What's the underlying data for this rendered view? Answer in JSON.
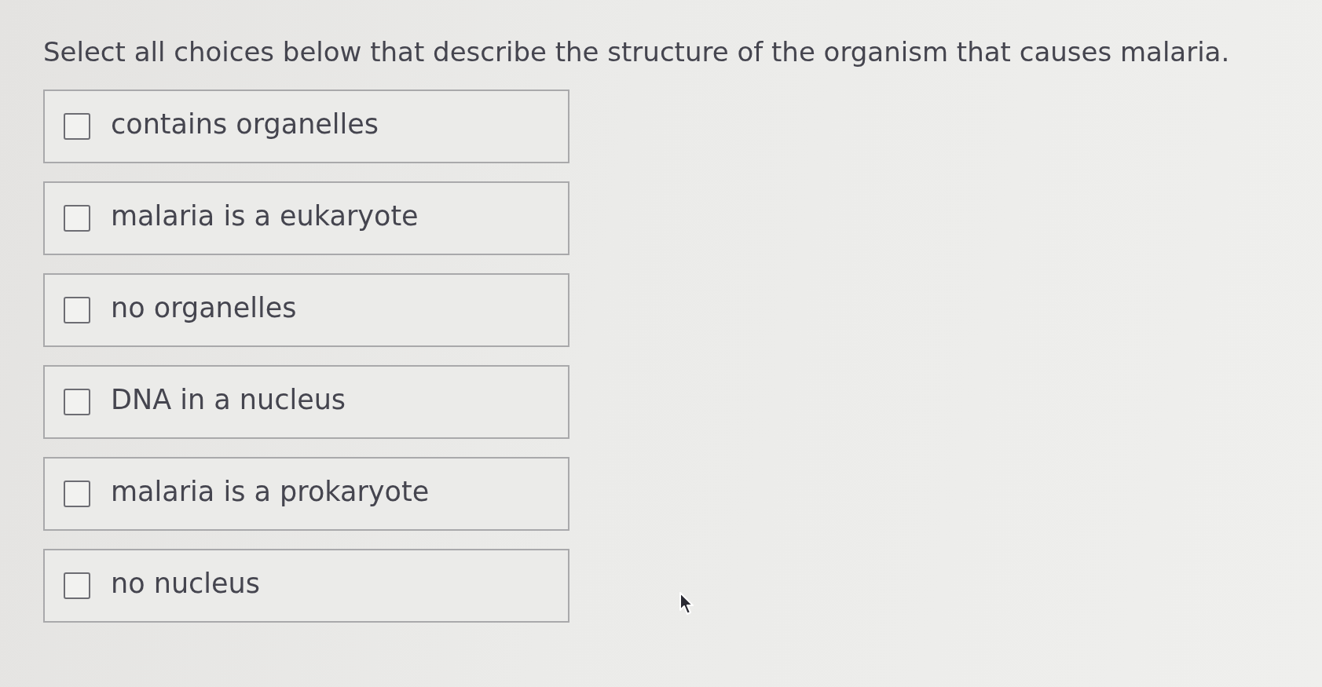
{
  "question": "Select all choices below that describe the structure of the organism that causes malaria.",
  "choices": [
    {
      "label": "contains organelles",
      "checked": false
    },
    {
      "label": "malaria is a eukaryote",
      "checked": false
    },
    {
      "label": "no organelles",
      "checked": false
    },
    {
      "label": "DNA in a nucleus",
      "checked": false
    },
    {
      "label": "malaria is a prokaryote",
      "checked": false
    },
    {
      "label": "no nucleus",
      "checked": false
    }
  ]
}
